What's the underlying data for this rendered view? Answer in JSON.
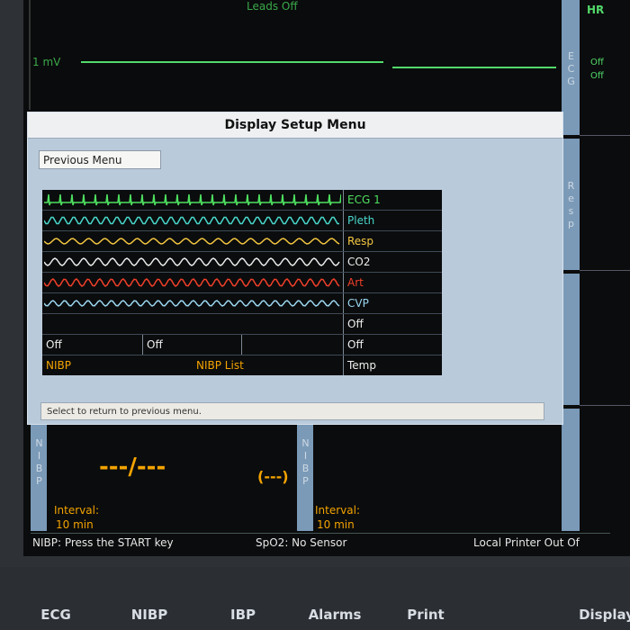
{
  "top": {
    "leads_off": "Leads Off",
    "scale_label": "1 mV"
  },
  "right_panel": {
    "hr_label": "HR",
    "ecg_strip": "ECG",
    "ecg_off_1": "Off",
    "ecg_off_2": "Off",
    "resp_strip": "Resp"
  },
  "menu": {
    "title": "Display Setup Menu",
    "previous_menu": "Previous Menu",
    "waves": [
      {
        "label": "ECG 1",
        "color": "#4ee060"
      },
      {
        "label": "Pleth",
        "color": "#48d8cc"
      },
      {
        "label": "Resp",
        "color": "#f5c842"
      },
      {
        "label": "CO2",
        "color": "#ececec"
      },
      {
        "label": "Art",
        "color": "#f0402a"
      },
      {
        "label": "CVP",
        "color": "#9ad6f0"
      }
    ],
    "row7_label": "Off",
    "row8": {
      "cell1": "Off",
      "cell2": "Off",
      "cell3": "",
      "label": "Off"
    },
    "row9": {
      "cell1": "NIBP",
      "cell2": "NIBP List",
      "label": "Temp"
    },
    "status_text": "Select to return to previous menu."
  },
  "nibp_left": {
    "strip": "NIBP",
    "value": "---/---",
    "mean": "(---)",
    "interval_label": "Interval:",
    "interval_value": "10 min"
  },
  "nibp_right": {
    "strip": "NIBP",
    "interval_label": "Interval:",
    "interval_value": "10 min"
  },
  "status_bar": {
    "left": "NIBP: Press the START key",
    "middle": "SpO2: No Sensor",
    "right": "Local Printer Out Of Paper"
  },
  "keys": [
    "ECG",
    "NIBP",
    "IBP",
    "Alarms",
    "Print",
    "Display"
  ]
}
